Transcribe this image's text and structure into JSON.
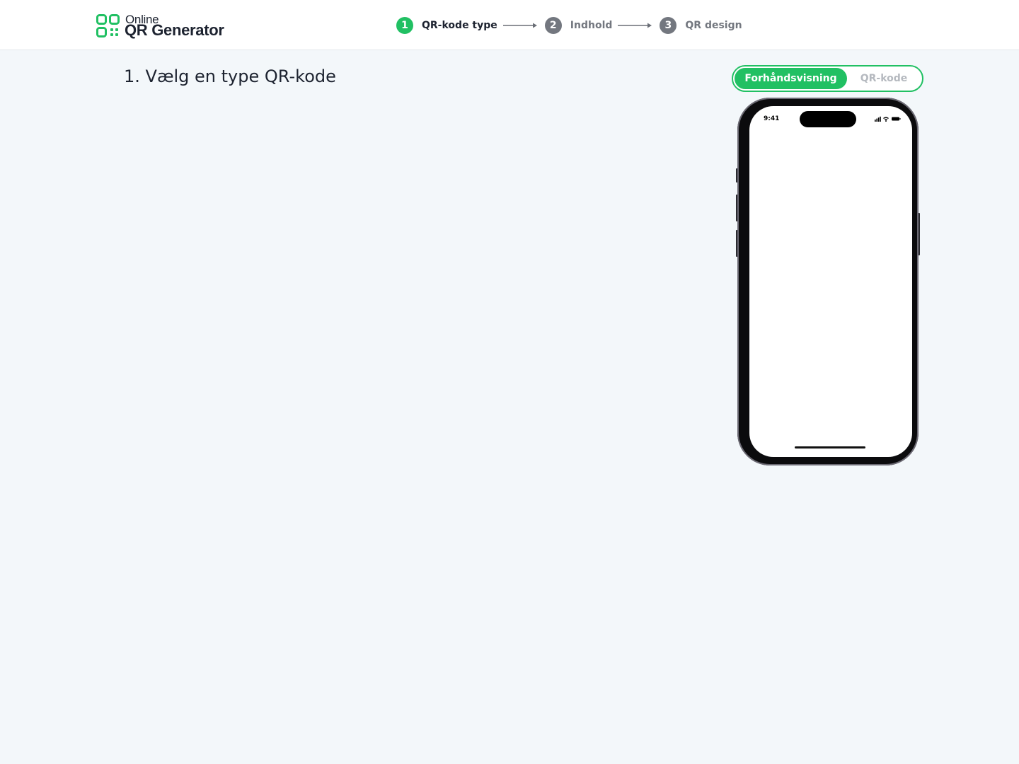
{
  "brand": {
    "line1": "Online",
    "line2": "QR Generator",
    "accent_color": "#21c063"
  },
  "steps": [
    {
      "number": "1",
      "label": "QR-kode type",
      "active": true
    },
    {
      "number": "2",
      "label": "Indhold",
      "active": false
    },
    {
      "number": "3",
      "label": "QR design",
      "active": false
    }
  ],
  "main": {
    "title": "1. Vælg en type QR-kode"
  },
  "preview_toggle": {
    "preview_label": "Forhåndsvisning",
    "qr_label": "QR-kode",
    "selected": "Forhåndsvisning"
  },
  "phone": {
    "status_time": "9:41",
    "status_icons": [
      "signal-icon",
      "wifi-icon",
      "battery-icon"
    ]
  }
}
